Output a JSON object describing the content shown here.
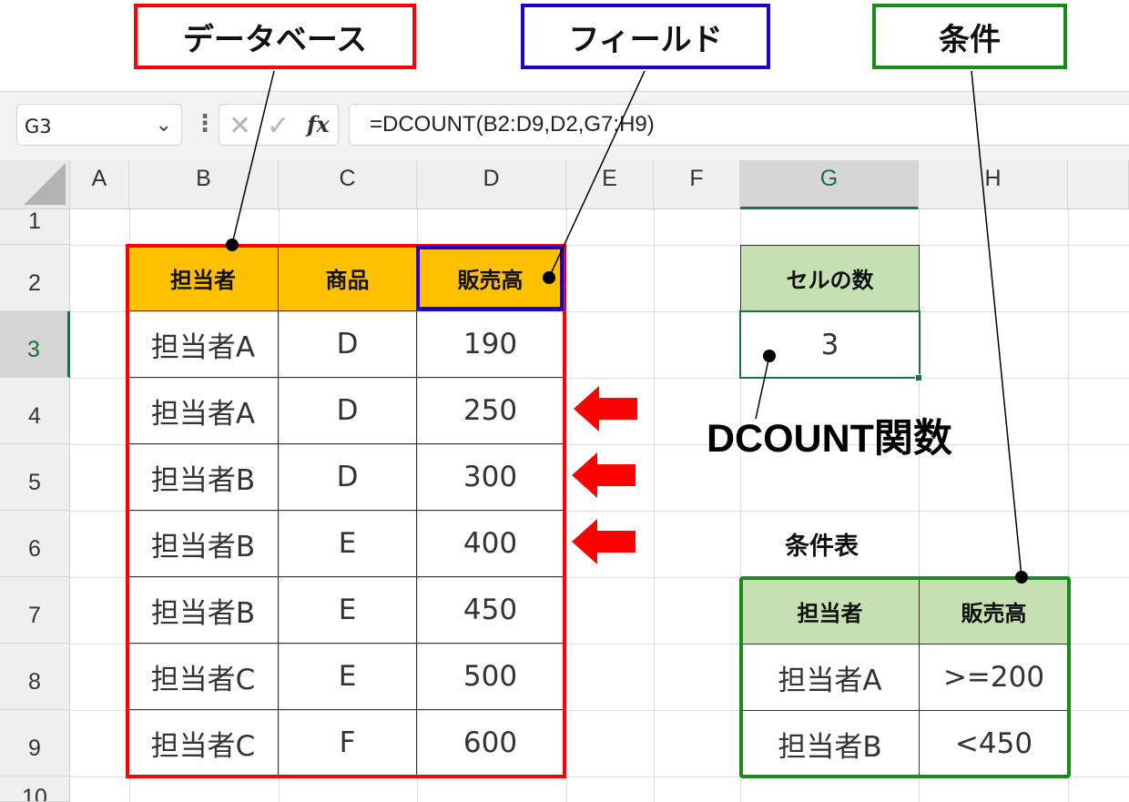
{
  "annotations": {
    "database": "データベース",
    "field": "フィールド",
    "criteria": "条件",
    "function_name": "DCOUNT関数",
    "criteria_table": "条件表"
  },
  "formula_bar": {
    "name_box": "G3",
    "formula": "=DCOUNT(B2:D9,D2,G7:H9)"
  },
  "columns": [
    "A",
    "B",
    "C",
    "D",
    "E",
    "F",
    "G",
    "H"
  ],
  "rows": [
    "1",
    "2",
    "3",
    "4",
    "5",
    "6",
    "7",
    "8",
    "9",
    "10"
  ],
  "selected_cell": "G3",
  "database_table": {
    "headers": [
      "担当者",
      "商品",
      "販売高"
    ],
    "rows": [
      [
        "担当者A",
        "D",
        "190"
      ],
      [
        "担当者A",
        "D",
        "250"
      ],
      [
        "担当者B",
        "D",
        "300"
      ],
      [
        "担当者B",
        "E",
        "400"
      ],
      [
        "担当者B",
        "E",
        "450"
      ],
      [
        "担当者C",
        "E",
        "500"
      ],
      [
        "担当者C",
        "F",
        "600"
      ]
    ]
  },
  "result_table": {
    "header": "セルの数",
    "value": "3"
  },
  "criteria_table": {
    "headers": [
      "担当者",
      "販売高"
    ],
    "rows": [
      [
        "担当者A",
        ">=200"
      ],
      [
        "担当者B",
        "<450"
      ]
    ]
  },
  "colors": {
    "database_border": "#ff0000",
    "field_border": "#2200cc",
    "criteria_border": "#1a8a1a",
    "header_orange": "#ffc000",
    "header_green": "#c6e0b4",
    "arrow_red": "#ff0000"
  }
}
